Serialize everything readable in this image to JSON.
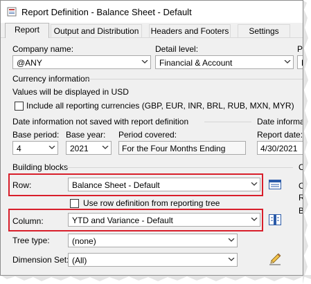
{
  "window": {
    "title": "Report Definition - Balance Sheet - Default"
  },
  "tabs": [
    {
      "label": "Report",
      "active": true
    },
    {
      "label": "Output and Distribution",
      "active": false
    },
    {
      "label": "Headers and Footers",
      "active": false
    },
    {
      "label": "Settings",
      "active": false
    }
  ],
  "company": {
    "label": "Company name:",
    "value": "@ANY"
  },
  "detail": {
    "label": "Detail level:",
    "value": "Financial & Account"
  },
  "truncated": {
    "label_p": "Pr",
    "value_p": "P"
  },
  "currency": {
    "section": "Currency information",
    "note": "Values will be displayed in USD",
    "include_label": "Include all reporting currencies (GBP, EUR, INR, BRL, RUB, MXN, MYR)"
  },
  "date_info": {
    "section": "Date information not saved with report definition",
    "section_right": "Date informati",
    "base_period_label": "Base period:",
    "base_period_value": "4",
    "base_year_label": "Base year:",
    "base_year_value": "2021",
    "period_covered_label": "Period covered:",
    "period_covered_value": "For the Four Months Ending",
    "report_date_label": "Report date:",
    "report_date_value": "4/30/2021"
  },
  "building_blocks": {
    "section": "Building blocks",
    "section_right": "O",
    "row_label": "Row:",
    "row_value": "Balance Sheet - Default",
    "use_row_def_label": "Use row definition from reporting tree",
    "column_label": "Column:",
    "column_value": "YTD and Variance - Default",
    "tree_type_label": "Tree type:",
    "tree_type_value": "(none)",
    "dimension_set_label": "Dimension Set:",
    "dimension_set_value": "(All)",
    "right_fragments": [
      "O",
      "R",
      "B"
    ]
  },
  "colors": {
    "highlight": "#d81e2a",
    "window_bg": "#f0f0f0",
    "icon_blue": "#2a5aa8"
  }
}
